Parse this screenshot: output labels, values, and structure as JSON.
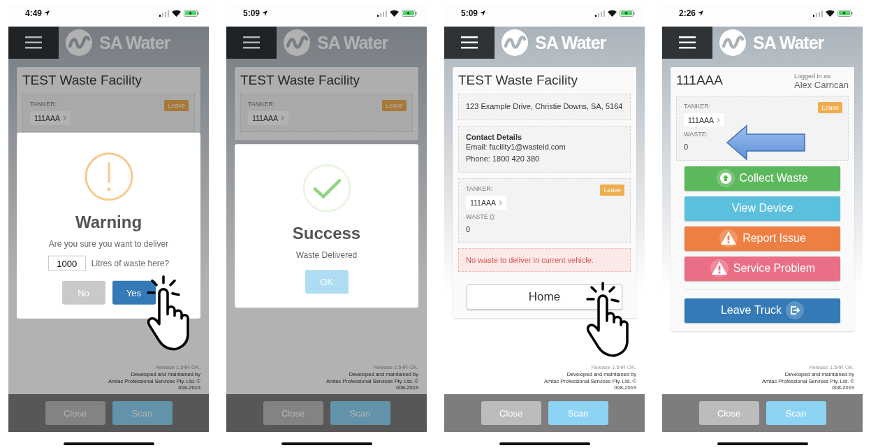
{
  "phones": [
    {
      "time": "4:49",
      "logo": "SA Water",
      "dimmed": true,
      "card": {
        "title": "TEST Waste Facility",
        "tanker": {
          "label": "TANKER:",
          "value": "111AAA",
          "leave": "Leave"
        }
      },
      "modal": {
        "kind": "warning",
        "title": "Warning",
        "text": "Are you sure you want to deliver",
        "quantity": "1000",
        "suffix": "Litres of waste here?",
        "buttons": [
          {
            "label": "No",
            "kind": "cancel",
            "tapped": false
          },
          {
            "label": "Yes",
            "kind": "confirm",
            "tapped": true
          }
        ]
      },
      "footer": [
        "Release 1.54R OK.",
        "Developed and maintained by",
        "Amtac Professional Services Pty. Ltd. ©",
        "008-2019"
      ],
      "bottom_buttons": [
        {
          "label": "Close",
          "kind": "close"
        },
        {
          "label": "Scan",
          "kind": "scan"
        }
      ]
    },
    {
      "time": "5:09",
      "logo": "SA Water",
      "dimmed": true,
      "card": {
        "title": "TEST Waste Facility",
        "tanker": {
          "label": "TANKER:",
          "value": "111AAA",
          "leave": "Leave"
        }
      },
      "modal": {
        "kind": "success",
        "title": "Success",
        "text": "Waste Delivered",
        "buttons": [
          {
            "label": "OK",
            "kind": "ok",
            "tapped": false
          }
        ]
      },
      "footer": [
        "Release 1.54R OK.",
        "Developed and maintained by",
        "Amtac Professional Services Pty. Ltd. ©",
        "008-2019"
      ],
      "bottom_buttons": [
        {
          "label": "Close",
          "kind": "close"
        },
        {
          "label": "Scan",
          "kind": "scan"
        }
      ]
    },
    {
      "time": "5:09",
      "logo": "SA Water",
      "dimmed": false,
      "card": {
        "title": "TEST Waste Facility",
        "address": "123 Example Drive, Christie Downs, SA, 5164",
        "contact": {
          "heading": "Contact Details",
          "lines": [
            "Email: facility1@wasteid.com",
            "Phone: 1800 420 380"
          ]
        },
        "tanker": {
          "label": "TANKER:",
          "value": "111AAA",
          "leave": "Leave",
          "waste_label": "WASTE ():",
          "waste": "0"
        },
        "alert": "No waste to deliver in current vehicle.",
        "home": {
          "label": "Home",
          "tapped": true
        }
      },
      "footer": [
        "Release 1.54R OK.",
        "Developed and maintained by",
        "Amtac Professional Services Pty. Ltd. ©",
        "008-2019"
      ],
      "bottom_buttons": [
        {
          "label": "Close",
          "kind": "close"
        },
        {
          "label": "Scan",
          "kind": "scan"
        }
      ]
    },
    {
      "time": "2:26",
      "logo": "SA Water",
      "dimmed": false,
      "card": {
        "title": "111AAA",
        "user": {
          "label": "Logged in as:",
          "name": "Alex Carrican"
        },
        "tanker": {
          "label": "TANKER:",
          "value": "111AAA",
          "leave": "Leave",
          "waste_label": "WASTE:",
          "waste": "0",
          "highlighted": true
        },
        "actions": [
          {
            "label": "Collect Waste",
            "kind": "collect"
          },
          {
            "label": "View Device",
            "kind": "view"
          },
          {
            "label": "Report Issue",
            "kind": "report"
          },
          {
            "label": "Service Problem",
            "kind": "service"
          },
          {
            "label": "Leave Truck",
            "kind": "leave"
          }
        ]
      },
      "footer": [
        "Release 1.54R OK.",
        "Developed and maintained by",
        "Amtac Professional Services Pty. Ltd. ©",
        "008-2019"
      ],
      "bottom_buttons": [
        {
          "label": "Close",
          "kind": "close"
        },
        {
          "label": "Scan",
          "kind": "scan"
        }
      ]
    }
  ]
}
